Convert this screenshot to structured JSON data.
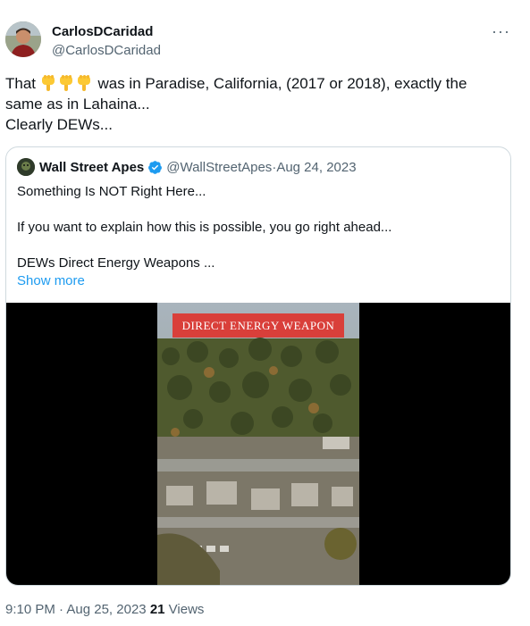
{
  "author": {
    "display_name": "CarlosDCaridad",
    "handle": "@CarlosDCaridad"
  },
  "more_icon": "more-horizontal-icon",
  "tweet": {
    "text_before_emoji": "That ",
    "emoji": "pointing-down-emoji",
    "emoji_count": 3,
    "text_after_emoji": " was in Paradise, California, (2017 or 2018), exactly the same as in Lahaina...",
    "line2": "Clearly DEWs..."
  },
  "quote": {
    "display_name": "Wall Street Apes",
    "verified": true,
    "handle": "@WallStreetApes",
    "separator": " · ",
    "date": "Aug 24, 2023",
    "line1": "Something Is NOT Right Here...",
    "line2": "If you want to explain how this is possible, you go right ahead...",
    "line3": "DEWs Direct Energy Weapons ...",
    "show_more": "Show more",
    "media": {
      "banner_text": "DIRECT ENERGY WEAPON"
    }
  },
  "footer": {
    "time": "9:10 PM",
    "separator": " · ",
    "date": "Aug 25, 2023",
    "views_count": "21",
    "views_label": "Views"
  },
  "colors": {
    "link": "#1d9bf0",
    "secondary_text": "#536471",
    "banner": "#d93f3a"
  }
}
